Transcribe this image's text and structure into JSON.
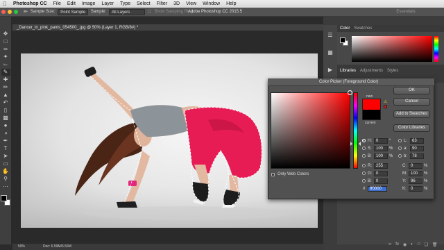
{
  "menubar": {
    "app_name": "Photoshop CC",
    "items": [
      "File",
      "Edit",
      "Image",
      "Layer",
      "Type",
      "Select",
      "Filter",
      "3D",
      "View",
      "Window",
      "Help"
    ]
  },
  "window_title": "Adobe Photoshop CC 2015.5",
  "options_bar": {
    "sample_size_label": "Sample Size:",
    "sample_size_value": "Point Sample",
    "sample_label": "Sample:",
    "sample_value": "All Layers",
    "show_ring_label": "Show Sampling Ring",
    "workspace": "Essentials"
  },
  "document": {
    "tab_title": "_Dancer_in_pink_pants_054500_.jpg @ 50% (Layer 1, RGB/8#) *",
    "zoom": "50%",
    "doc_info": "Doc: 6.59M/6.59M"
  },
  "panels": {
    "color_tab": "Color",
    "swatches_tab": "Swatches",
    "libraries_tab": "Libraries",
    "adjustments_tab": "Adjustments",
    "styles_tab": "Styles"
  },
  "color_picker": {
    "title": "Color Picker (Foreground Color)",
    "new_label": "new",
    "current_label": "current",
    "buttons": {
      "ok": "OK",
      "cancel": "Cancel",
      "add_to_swatches": "Add to Swatches",
      "color_libraries": "Color Libraries"
    },
    "only_web_colors": "Only Web Colors",
    "hsb": [
      {
        "label": "H:",
        "value": "0",
        "unit": "°"
      },
      {
        "label": "S:",
        "value": "100",
        "unit": "%"
      },
      {
        "label": "B:",
        "value": "100",
        "unit": "%"
      }
    ],
    "rgb": [
      {
        "label": "R:",
        "value": "255"
      },
      {
        "label": "G:",
        "value": "0"
      },
      {
        "label": "B:",
        "value": "0"
      }
    ],
    "lab": [
      {
        "label": "L:",
        "value": "63"
      },
      {
        "label": "a:",
        "value": "90"
      },
      {
        "label": "b:",
        "value": "78"
      }
    ],
    "cmyk": [
      {
        "label": "C:",
        "value": "0",
        "unit": "%"
      },
      {
        "label": "M:",
        "value": "100",
        "unit": "%"
      },
      {
        "label": "Y:",
        "value": "96",
        "unit": "%"
      },
      {
        "label": "K:",
        "value": "0",
        "unit": "%"
      }
    ],
    "hex_label": "#",
    "hex_value": "ff0000",
    "new_color": "#ff0000",
    "current_color": "#000000"
  }
}
